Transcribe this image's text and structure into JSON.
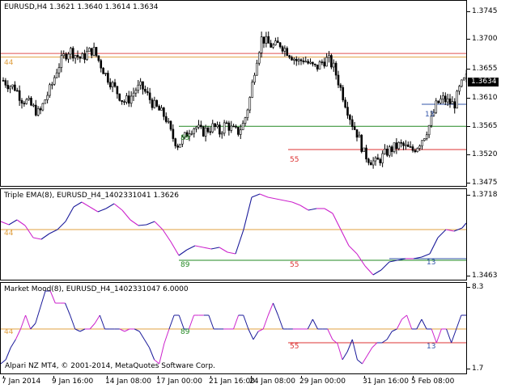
{
  "main": {
    "title": "EURUSD,H4  1.3621 1.3640 1.3614 1.3634",
    "price_labels": [
      "1.3745",
      "1.3700",
      "1.3655",
      "1.3610",
      "1.3565",
      "1.3520",
      "1.3475"
    ],
    "current_price": "1.3634",
    "levels": [
      {
        "label": "44",
        "price": 1.3668,
        "color": "#E0A040"
      },
      {
        "label": "13",
        "price": 1.3591,
        "color": "#3355AA"
      },
      {
        "label": "89",
        "price": 1.3555,
        "color": "#228822"
      },
      {
        "label": "55",
        "price": 1.3517,
        "color": "#DD3333"
      }
    ],
    "resistance_color": "#E05050"
  },
  "tema": {
    "title": "Triple EMA(8), EURUSD_H4_1402331041 1.3626",
    "price_labels": [
      "1.3718",
      "1.3463"
    ],
    "levels": [
      {
        "label": "44",
        "value": 0.58,
        "color": "#E0A040"
      },
      {
        "label": "89",
        "value": 0.25,
        "color": "#228822"
      },
      {
        "label": "13",
        "value": 0.26,
        "color": "#3355AA"
      },
      {
        "label": "55",
        "value": 0.25,
        "color": "#DD3333"
      }
    ]
  },
  "mood": {
    "title": "Market Mood(8), EURUSD_H4_1402331047 6.0000",
    "price_labels": [
      "8.3",
      "1.7"
    ]
  },
  "time_labels": [
    "7 Jan 2014",
    "9 Jan 16:00",
    "14 Jan 08:00",
    "17 Jan 00:00",
    "21 Jan 16:00",
    "24 Jan 08:00",
    "29 Jan 00:00",
    "31 Jan 16:00",
    "5 Feb 08:00"
  ],
  "copyright": "Alpari NZ MT4, © 2001-2014, MetaQuotes Software Corp.",
  "colors": {
    "up": "#000000",
    "tema_up": "#1a1a9a",
    "tema_down": "#CC22CC",
    "grid": "#000000"
  },
  "chart_data": {
    "type": "line",
    "symbol": "EURUSD",
    "timeframe": "H4",
    "ylim": [
      1.3455,
      1.376
    ],
    "close_series": [
      1.363,
      1.3622,
      1.3618,
      1.36,
      1.3595,
      1.3585,
      1.3575,
      1.36,
      1.362,
      1.365,
      1.3668,
      1.368,
      1.3672,
      1.3665,
      1.3675,
      1.368,
      1.366,
      1.364,
      1.3625,
      1.361,
      1.3595,
      1.36,
      1.3615,
      1.362,
      1.3605,
      1.359,
      1.358,
      1.357,
      1.354,
      1.3525,
      1.3535,
      1.355,
      1.3555,
      1.3545,
      1.355,
      1.3555,
      1.3545,
      1.356,
      1.355,
      1.3545,
      1.356,
      1.36,
      1.366,
      1.37,
      1.369,
      1.3685,
      1.369,
      1.368,
      1.367,
      1.366,
      1.3665,
      1.3655,
      1.365,
      1.366,
      1.3665,
      1.365,
      1.362,
      1.359,
      1.356,
      1.354,
      1.351,
      1.35,
      1.3495,
      1.3505,
      1.3515,
      1.352,
      1.3525,
      1.352,
      1.3515,
      1.3525,
      1.354,
      1.356,
      1.359,
      1.36,
      1.3595,
      1.359,
      1.362,
      1.3634
    ]
  }
}
